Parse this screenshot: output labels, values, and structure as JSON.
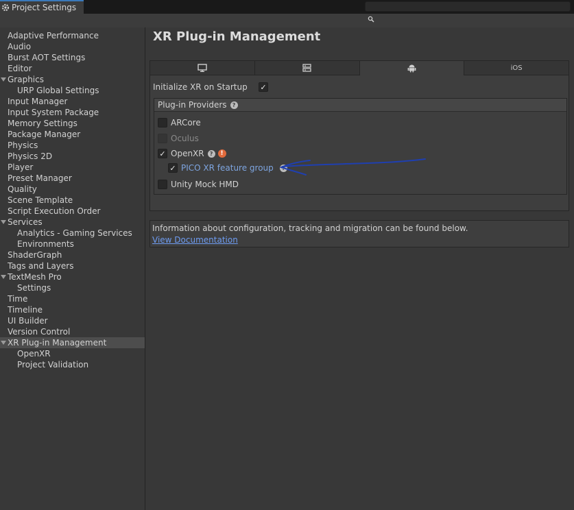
{
  "window": {
    "tab_title": "Project Settings",
    "controls": [
      "⋮",
      "□",
      "✕"
    ]
  },
  "search": {
    "value": "",
    "placeholder": ""
  },
  "sidebar": {
    "items": [
      {
        "label": "Adaptive Performance",
        "level": 0
      },
      {
        "label": "Audio",
        "level": 0
      },
      {
        "label": "Burst AOT Settings",
        "level": 0
      },
      {
        "label": "Editor",
        "level": 0
      },
      {
        "label": "Graphics",
        "level": 0,
        "expanded": true
      },
      {
        "label": "URP Global Settings",
        "level": 1
      },
      {
        "label": "Input Manager",
        "level": 0
      },
      {
        "label": "Input System Package",
        "level": 0
      },
      {
        "label": "Memory Settings",
        "level": 0
      },
      {
        "label": "Package Manager",
        "level": 0
      },
      {
        "label": "Physics",
        "level": 0
      },
      {
        "label": "Physics 2D",
        "level": 0
      },
      {
        "label": "Player",
        "level": 0
      },
      {
        "label": "Preset Manager",
        "level": 0
      },
      {
        "label": "Quality",
        "level": 0
      },
      {
        "label": "Scene Template",
        "level": 0
      },
      {
        "label": "Script Execution Order",
        "level": 0
      },
      {
        "label": "Services",
        "level": 0,
        "expanded": true
      },
      {
        "label": "Analytics - Gaming Services",
        "level": 1
      },
      {
        "label": "Environments",
        "level": 1
      },
      {
        "label": "ShaderGraph",
        "level": 0
      },
      {
        "label": "Tags and Layers",
        "level": 0
      },
      {
        "label": "TextMesh Pro",
        "level": 0,
        "expanded": true
      },
      {
        "label": "Settings",
        "level": 1
      },
      {
        "label": "Time",
        "level": 0
      },
      {
        "label": "Timeline",
        "level": 0
      },
      {
        "label": "UI Builder",
        "level": 0
      },
      {
        "label": "Version Control",
        "level": 0
      },
      {
        "label": "XR Plug-in Management",
        "level": 0,
        "expanded": true,
        "selected": true
      },
      {
        "label": "OpenXR",
        "level": 1
      },
      {
        "label": "Project Validation",
        "level": 1
      }
    ]
  },
  "main": {
    "title": "XR Plug-in Management",
    "platform_tabs": [
      {
        "icon": "monitor-icon",
        "label": ""
      },
      {
        "icon": "server-icon",
        "label": ""
      },
      {
        "icon": "android-icon",
        "label": "",
        "active": true
      },
      {
        "icon": "",
        "label": "iOS"
      }
    ],
    "init_on_startup": {
      "label": "Initialize XR on Startup",
      "checked": true
    },
    "providers": {
      "header": "Plug-in Providers",
      "items": [
        {
          "label": "ARCore",
          "checked": false,
          "enabled": true
        },
        {
          "label": "Oculus",
          "checked": false,
          "enabled": false
        },
        {
          "label": "OpenXR",
          "checked": true,
          "enabled": true,
          "help": true,
          "warning": true
        },
        {
          "label": "PICO XR feature group",
          "checked": true,
          "enabled": true,
          "help": true,
          "sub": true
        },
        {
          "label": "Unity Mock HMD",
          "checked": false,
          "enabled": true
        }
      ]
    },
    "info": {
      "text": "Information about configuration, tracking and migration can be found below.",
      "link": "View Documentation"
    }
  },
  "colors": {
    "accent_tab": "#3a79bb",
    "link": "#6e9cf2",
    "warning": "#e06a3c",
    "annotation_arrow": "#1f3fb0"
  }
}
